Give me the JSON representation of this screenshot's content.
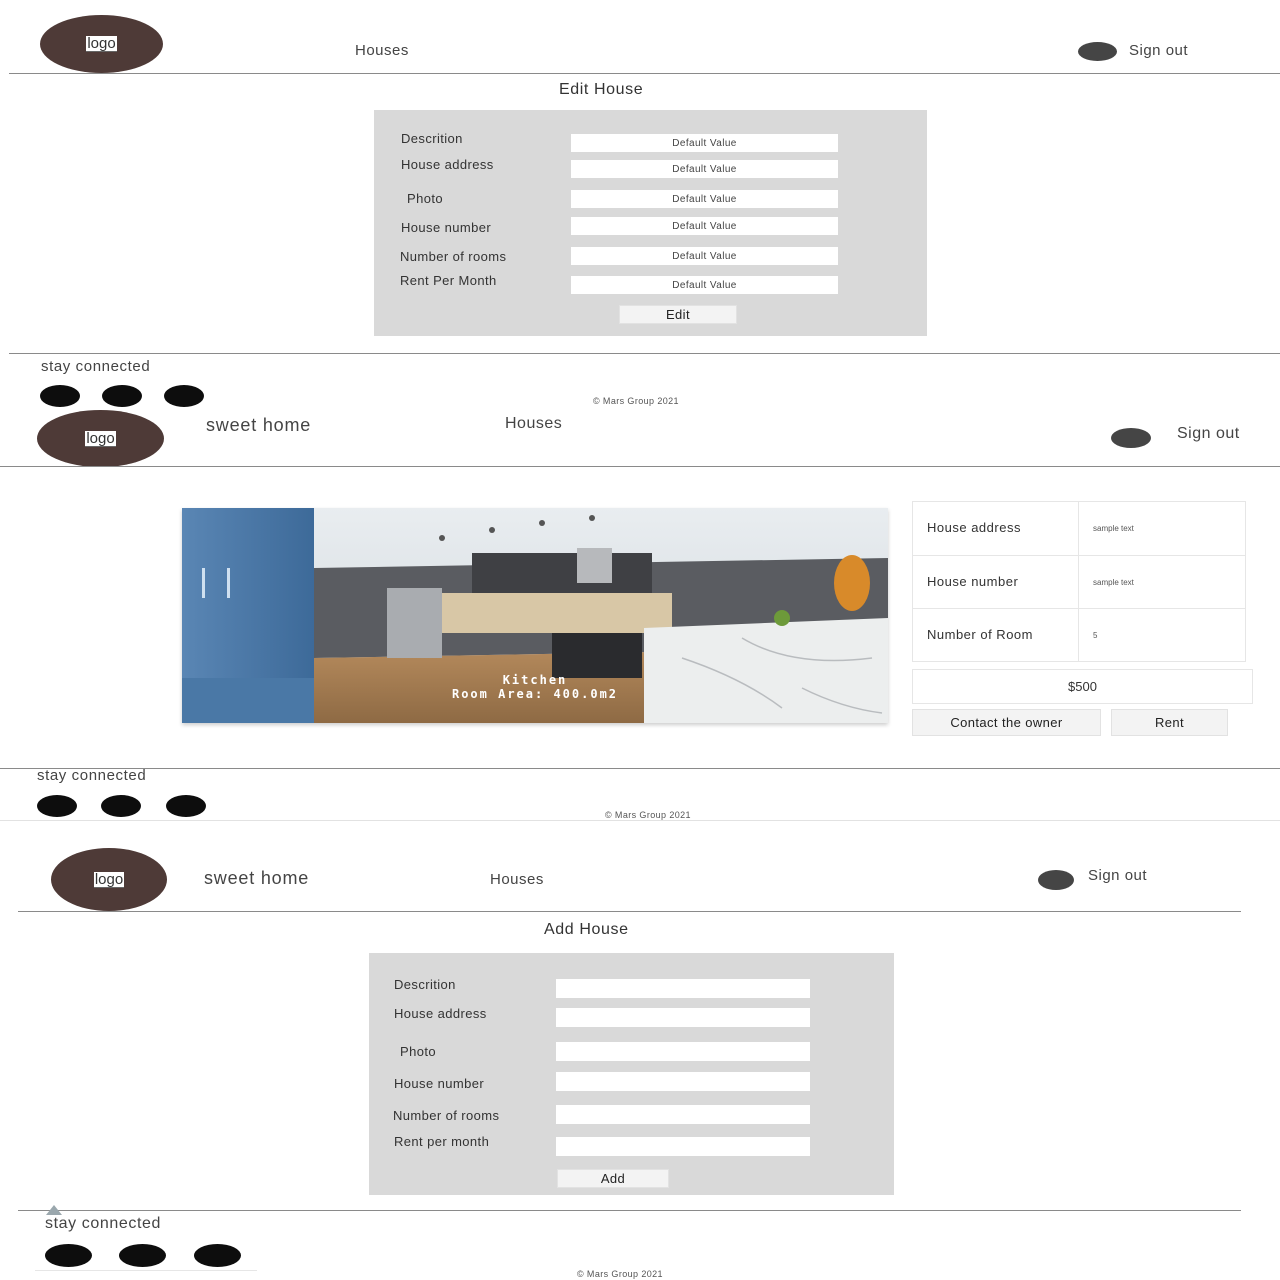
{
  "screens": {
    "edit": {
      "header": {
        "logo": "logo",
        "nav_houses": "Houses",
        "signout": "Sign out"
      },
      "title": "Edit House",
      "fields": [
        {
          "label": "Descrition",
          "value": "Default Value"
        },
        {
          "label": "House address",
          "value": "Default Value"
        },
        {
          "label": "Photo",
          "value": "Default Value"
        },
        {
          "label": "House number",
          "value": "Default Value"
        },
        {
          "label": "Number of rooms",
          "value": "Default Value"
        },
        {
          "label": "Rent Per Month",
          "value": "Default Value"
        }
      ],
      "submit": "Edit",
      "footer": {
        "stay": "stay connected",
        "copyright": "© Mars Group 2021"
      }
    },
    "detail": {
      "header": {
        "logo": "logo",
        "brand": "sweet home",
        "nav_houses": "Houses",
        "signout": "Sign out"
      },
      "photo": {
        "caption_line1": "Kitchen",
        "caption_line2": "Room Area: 400.0m2",
        "icon": "kitchen-photo"
      },
      "info": [
        {
          "label": "House address",
          "value": "sample text"
        },
        {
          "label": "House number",
          "value": "sample text"
        },
        {
          "label": "Number of Room",
          "value": "5"
        }
      ],
      "price": "$500",
      "contact": "Contact the owner",
      "rent": "Rent",
      "footer": {
        "stay": "stay connected",
        "copyright": "© Mars Group 2021"
      }
    },
    "add": {
      "header": {
        "logo": "logo",
        "brand": "sweet home",
        "nav_houses": "Houses",
        "signout": "Sign out"
      },
      "title": "Add House",
      "fields": [
        {
          "label": "Descrition",
          "value": ""
        },
        {
          "label": "House address",
          "value": ""
        },
        {
          "label": "Photo",
          "value": ""
        },
        {
          "label": "House number",
          "value": ""
        },
        {
          "label": "Number of rooms",
          "value": ""
        },
        {
          "label": "Rent per month",
          "value": ""
        }
      ],
      "submit": "Add",
      "footer": {
        "stay": "stay connected",
        "copyright": "© Mars Group 2021"
      }
    }
  },
  "colors": {
    "logo_bg": "#4e3a37",
    "panel_bg": "#d9d9d9",
    "avatar": "#454545",
    "social_dot": "#0d0d0d"
  }
}
